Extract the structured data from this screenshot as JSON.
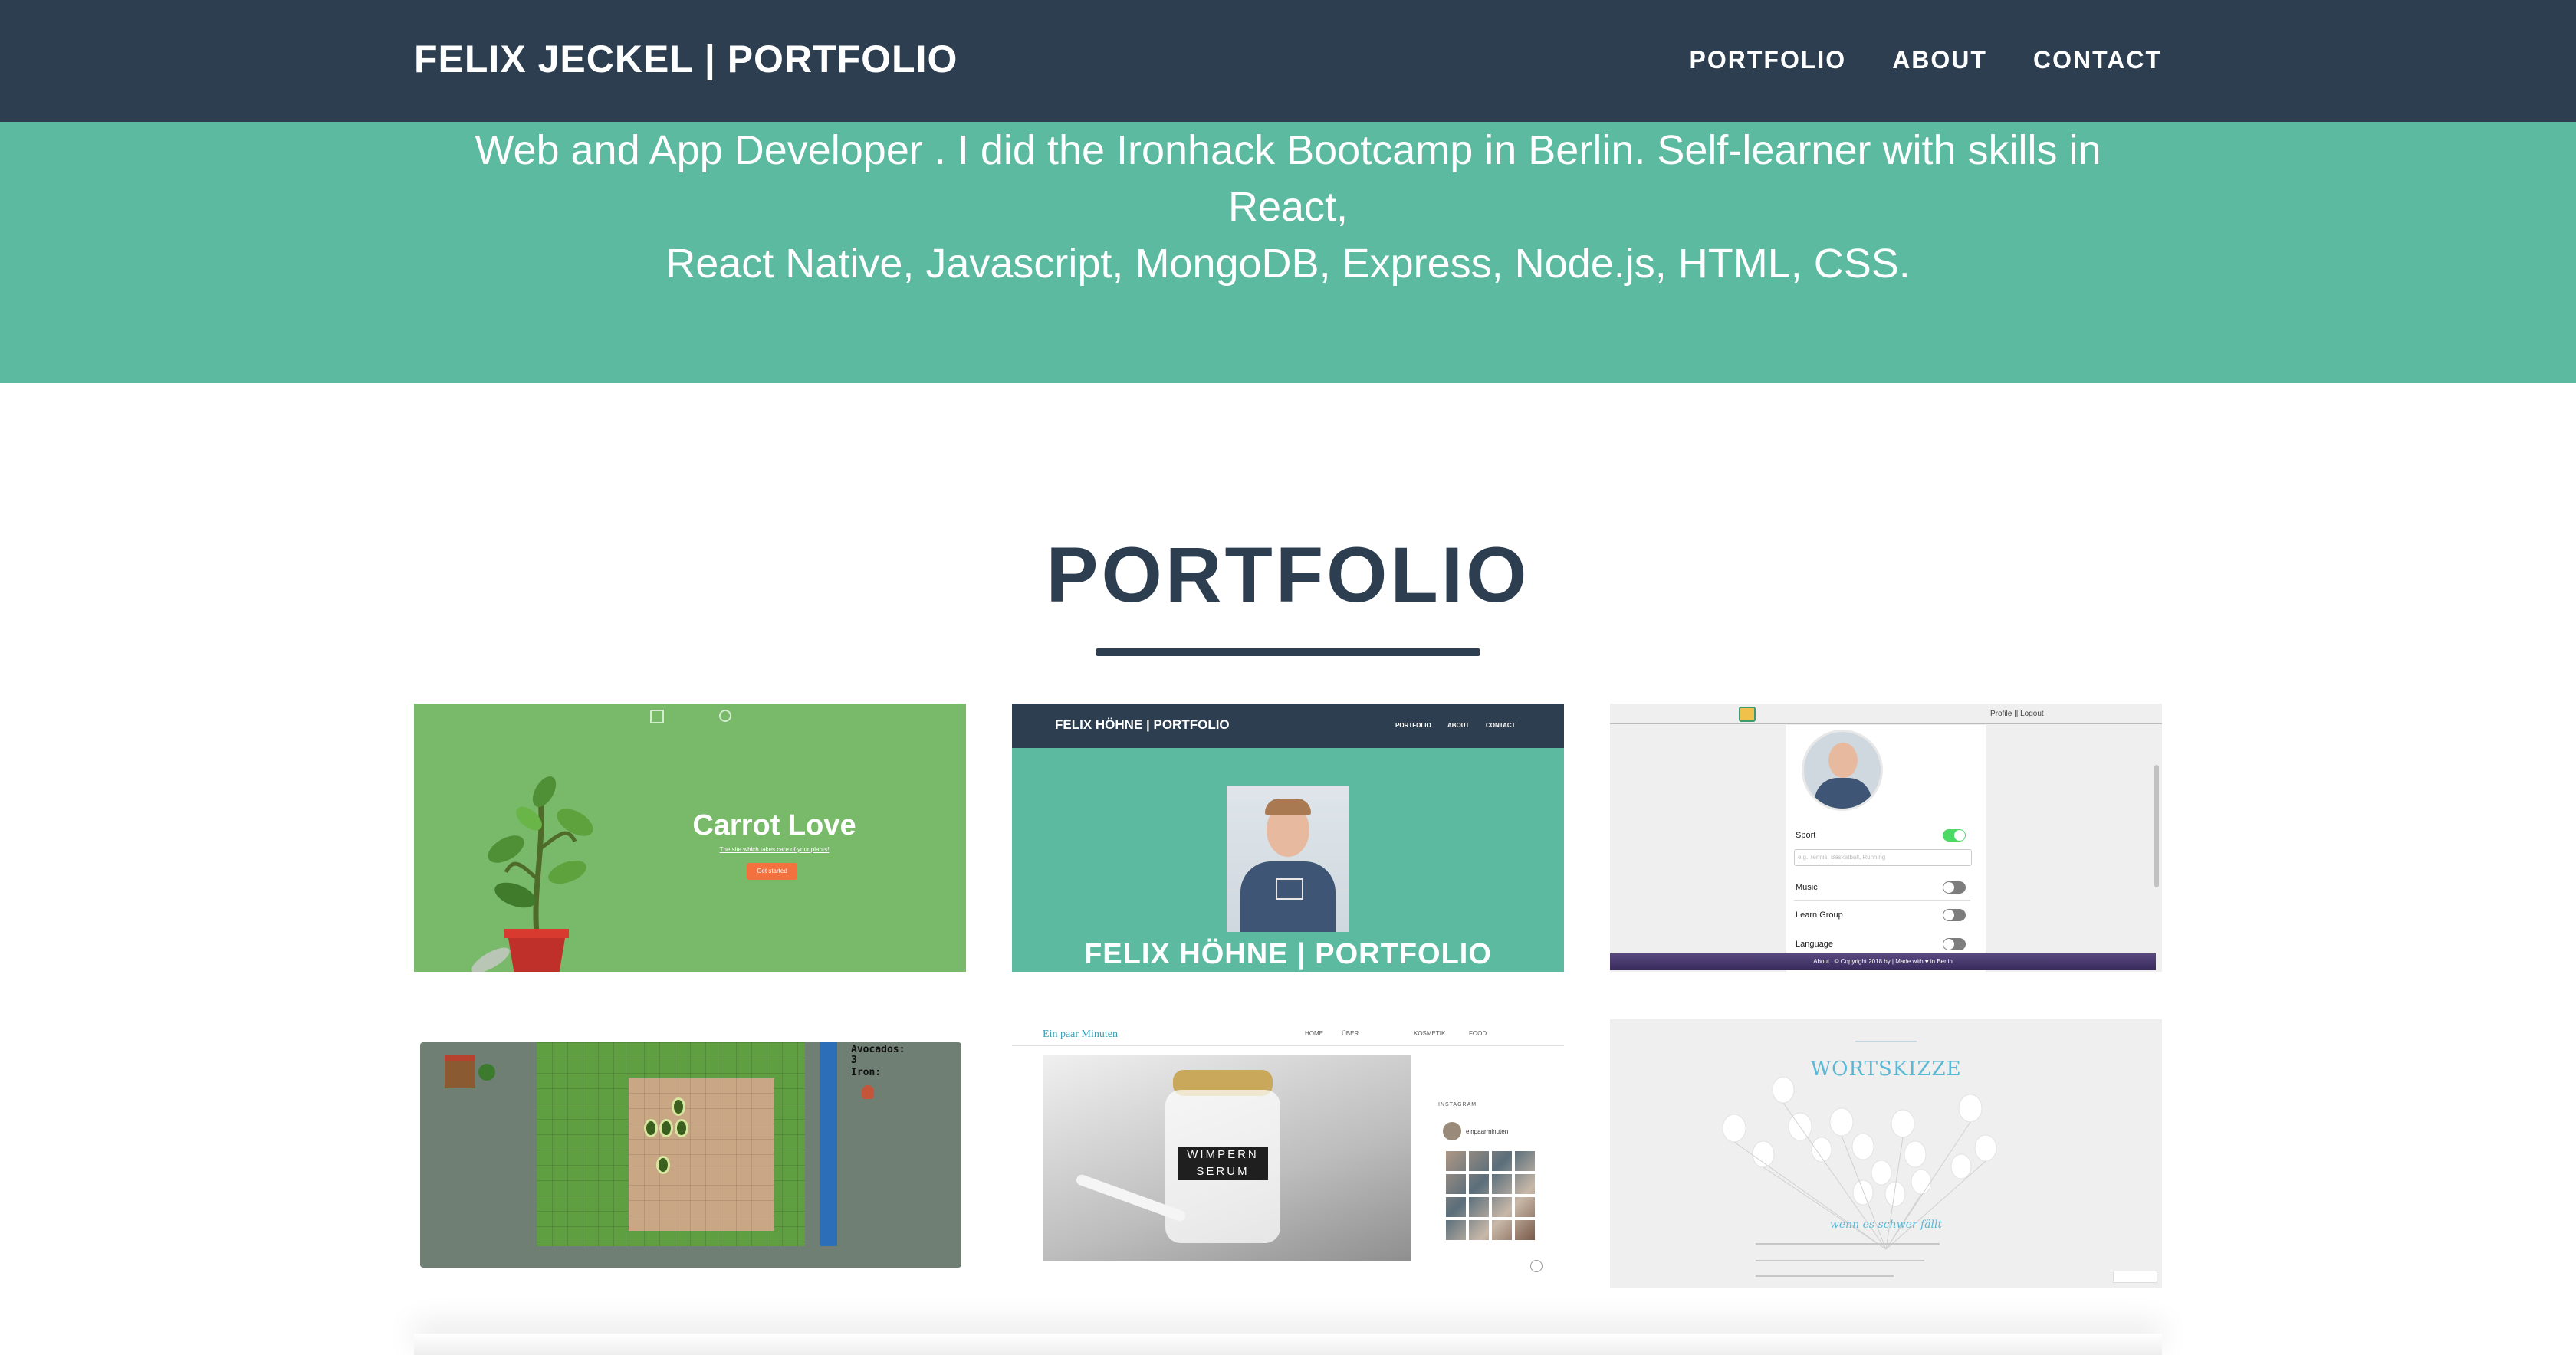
{
  "navbar": {
    "brand": "FELIX JECKEL | PORTFOLIO",
    "links": [
      "PORTFOLIO",
      "ABOUT",
      "CONTACT"
    ]
  },
  "masthead": {
    "line1": "Web and App Developer . I did the Ironhack Bootcamp in Berlin. Self-learner with skills in React,",
    "line2": "React Native, Javascript, MongoDB, Express, Node.js, HTML, CSS."
  },
  "portfolio": {
    "title": "PORTFOLIO",
    "items": [
      {
        "name": "Carrot Love",
        "subtitle": "The site which takes care of your plants!",
        "button": "Get started"
      },
      {
        "brand": "FELIX HÖHNE | PORTFOLIO",
        "nav": [
          "PORTFOLIO",
          "ABOUT",
          "CONTACT"
        ],
        "footer_title": "FELIX HÖHNE | PORTFOLIO"
      },
      {
        "header_links": "Profile || Logout",
        "toggles": [
          {
            "label": "Sport",
            "on": true
          },
          {
            "label": "Music",
            "on": false
          },
          {
            "label": "Learn Group",
            "on": false
          },
          {
            "label": "Language",
            "on": false
          }
        ],
        "input_placeholder": "e.g. Tennis, Basketball, Running",
        "footer": "About | © Copyright 2018 by | Made with ♥ in Berlin"
      },
      {
        "hud_line1": "Avocados:",
        "hud_line2": "3",
        "hud_line3": "Iron:"
      },
      {
        "site_title": "Ein paar Minuten",
        "nav": [
          "HOME",
          "ÜBER",
          "KOSMETIK",
          "FOOD"
        ],
        "jar_label": "WIMPERN SERUM",
        "instagram": "INSTAGRAM",
        "insta_user": "einpaarminuten"
      },
      {
        "title": "WORTSKIZZE",
        "caption": "wenn es schwer fällt"
      }
    ]
  },
  "colors": {
    "navbar": "#2c3e50",
    "masthead": "#5bba9f",
    "title": "#2c3e50"
  }
}
